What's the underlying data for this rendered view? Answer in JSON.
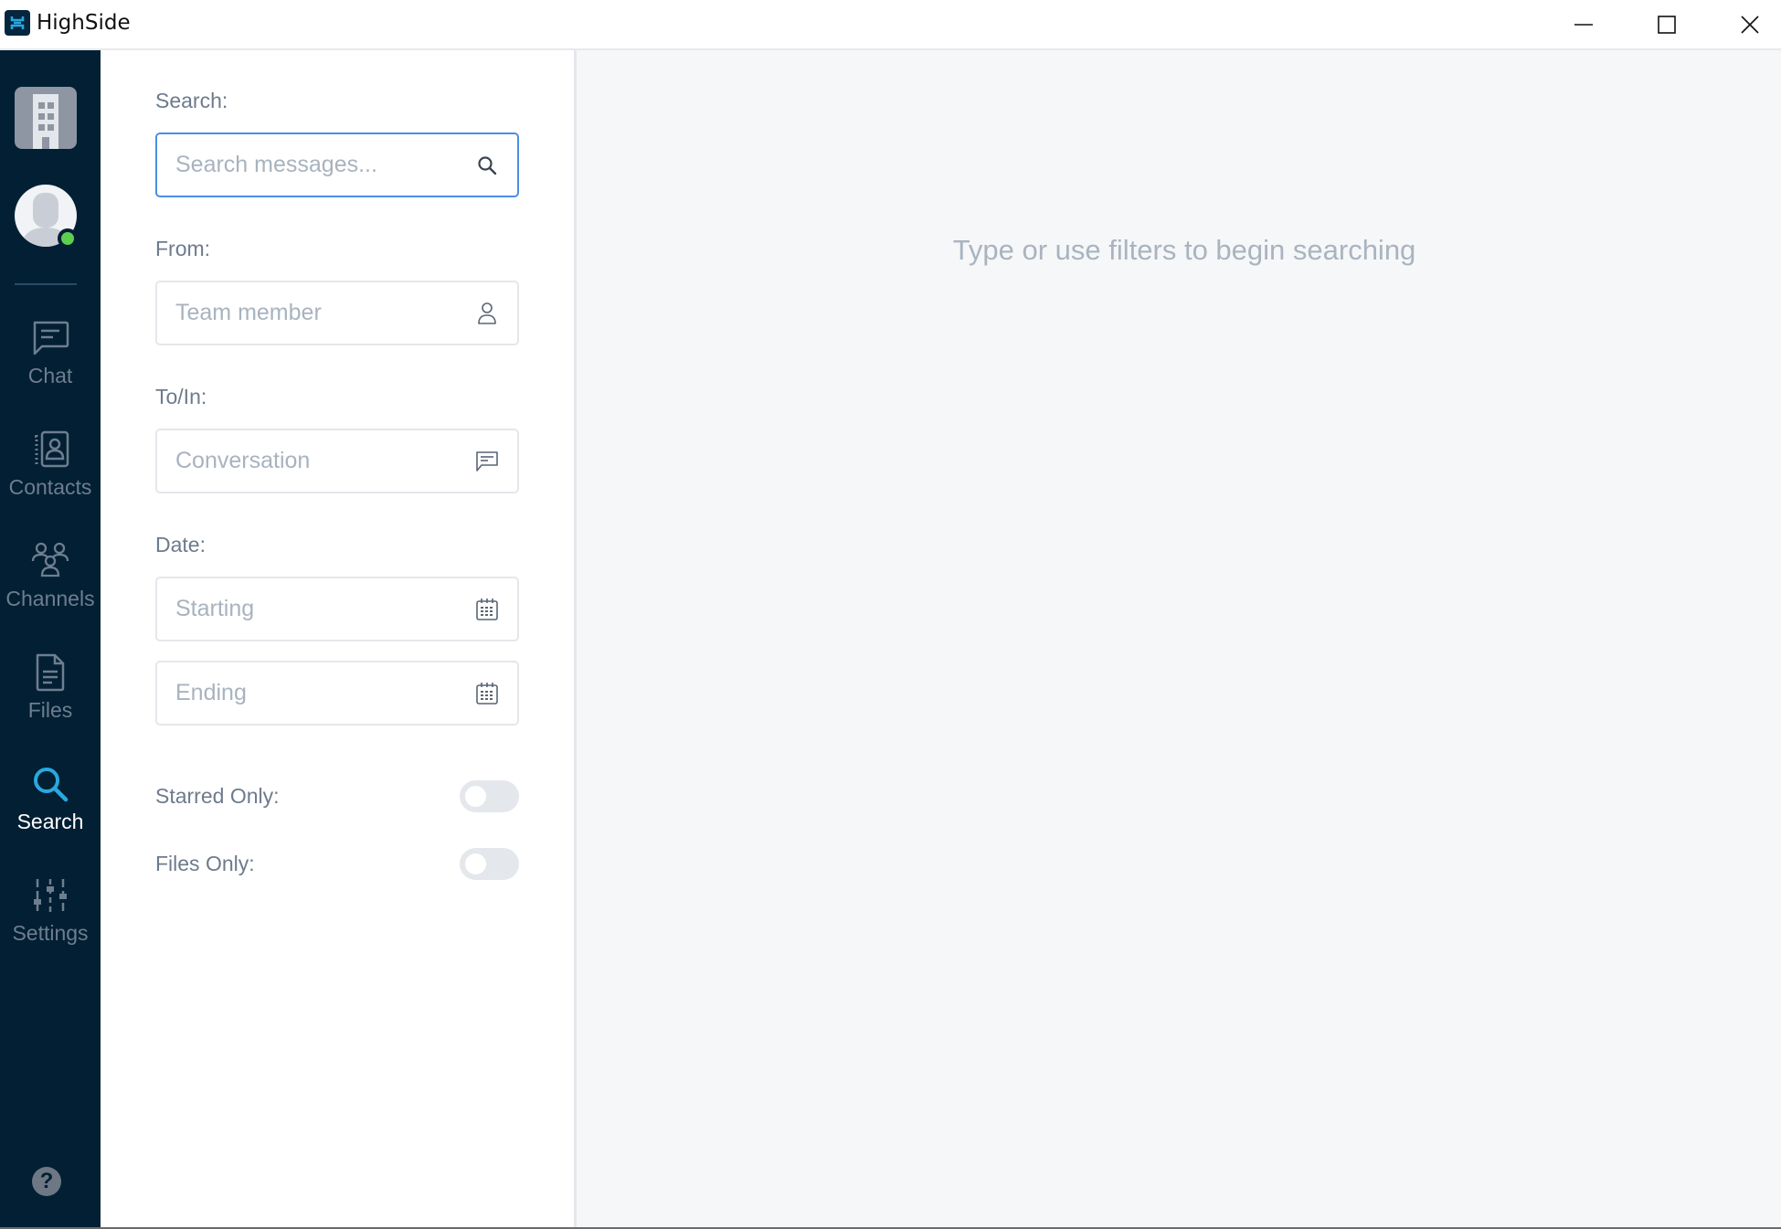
{
  "window": {
    "title": "HighSide",
    "controls": {
      "minimize": "minimize-icon",
      "maximize": "maximize-icon",
      "close": "close-icon"
    }
  },
  "sidebar": {
    "org_logo_icon": "building-icon",
    "avatar_icon": "user-silhouette-icon",
    "status": "online",
    "status_color": "#5ccf4f",
    "items": [
      {
        "label": "Chat",
        "icon": "chat-bubble-icon",
        "active": false
      },
      {
        "label": "Contacts",
        "icon": "contact-book-icon",
        "active": false
      },
      {
        "label": "Channels",
        "icon": "group-icon",
        "active": false
      },
      {
        "label": "Files",
        "icon": "file-icon",
        "active": false
      },
      {
        "label": "Search",
        "icon": "search-icon",
        "active": true
      },
      {
        "label": "Settings",
        "icon": "sliders-icon",
        "active": false
      }
    ],
    "help_label": "?",
    "accent_color": "#29a8df",
    "background_color": "#021f33"
  },
  "filters": {
    "search": {
      "label": "Search:",
      "placeholder": "Search messages...",
      "value": "",
      "icon": "search-icon"
    },
    "from": {
      "label": "From:",
      "placeholder": "Team member",
      "value": "",
      "icon": "person-icon"
    },
    "to_in": {
      "label": "To/In:",
      "placeholder": "Conversation",
      "value": "",
      "icon": "chat-bubble-icon"
    },
    "date": {
      "label": "Date:",
      "starting": {
        "placeholder": "Starting",
        "value": "",
        "icon": "calendar-icon"
      },
      "ending": {
        "placeholder": "Ending",
        "value": "",
        "icon": "calendar-icon"
      }
    },
    "starred_only": {
      "label": "Starred Only:",
      "on": false
    },
    "files_only": {
      "label": "Files Only:",
      "on": false
    }
  },
  "main": {
    "empty_message": "Type or use filters to begin searching"
  }
}
